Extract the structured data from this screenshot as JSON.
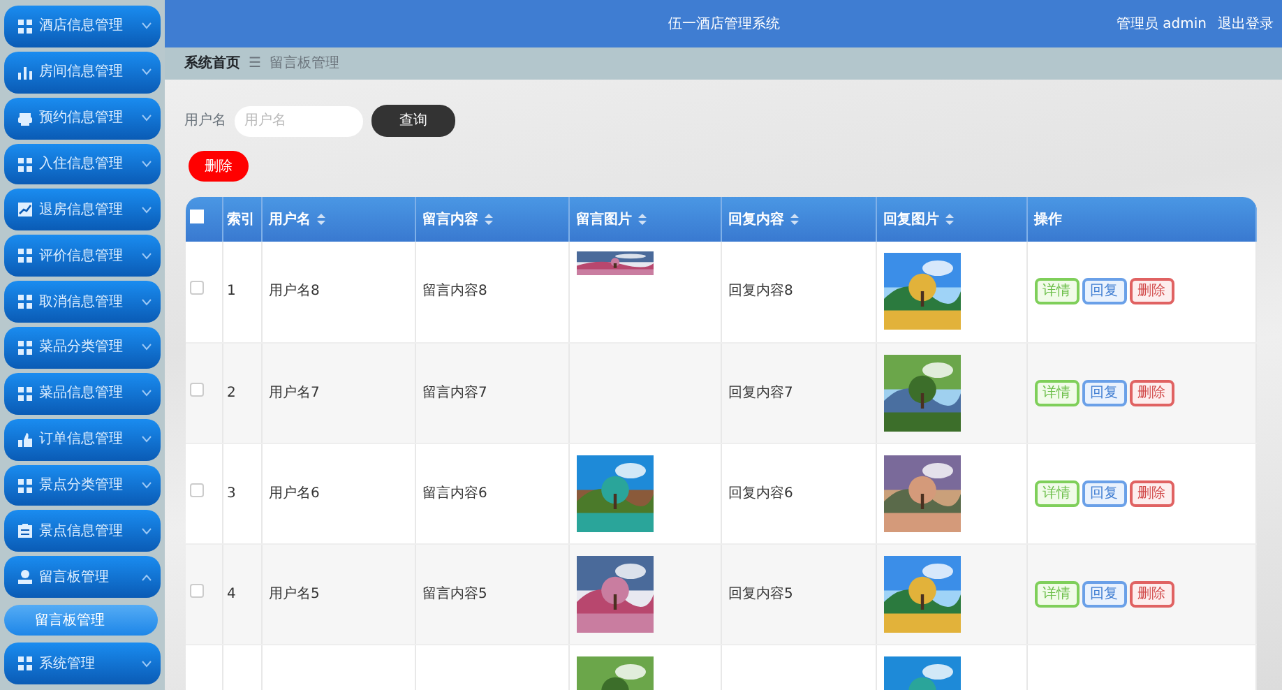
{
  "sidebar": {
    "items": [
      {
        "label": "酒店信息管理",
        "expanded": false
      },
      {
        "label": "房间信息管理",
        "expanded": false
      },
      {
        "label": "预约信息管理",
        "expanded": false
      },
      {
        "label": "入住信息管理",
        "expanded": false
      },
      {
        "label": "退房信息管理",
        "expanded": false
      },
      {
        "label": "评价信息管理",
        "expanded": false
      },
      {
        "label": "取消信息管理",
        "expanded": false
      },
      {
        "label": "菜品分类管理",
        "expanded": false
      },
      {
        "label": "菜品信息管理",
        "expanded": false
      },
      {
        "label": "订单信息管理",
        "expanded": false
      },
      {
        "label": "景点分类管理",
        "expanded": false
      },
      {
        "label": "景点信息管理",
        "expanded": false
      },
      {
        "label": "留言板管理",
        "expanded": true,
        "children": [
          {
            "label": "留言板管理",
            "selected": true
          }
        ]
      },
      {
        "label": "系统管理",
        "expanded": false
      }
    ]
  },
  "header": {
    "title": "伍一酒店管理系统",
    "user": "管理员 admin",
    "logout": "退出登录"
  },
  "breadcrumb": {
    "home": "系统首页",
    "separator": "☰",
    "current": "留言板管理"
  },
  "search": {
    "label": "用户名",
    "placeholder": "用户名",
    "button": "查询"
  },
  "delete_button": "删除",
  "table": {
    "select_all": {
      "checked": false
    },
    "columns": [
      "索引",
      "用户名",
      "留言内容",
      "留言图片",
      "回复内容",
      "回复图片",
      "操作"
    ],
    "rows": [
      {
        "checked": false,
        "index": "1",
        "username": "用户名8",
        "message": "留言内容8",
        "message_image": {
          "kind": "picture",
          "cropped": true
        },
        "reply": "回复内容8",
        "reply_image": {
          "kind": "picture"
        },
        "actions": [
          "详情",
          "回复",
          "删除"
        ]
      },
      {
        "checked": false,
        "index": "2",
        "username": "用户名7",
        "message": "留言内容7",
        "reply": "回复内容7",
        "reply_image": {
          "kind": "picture"
        },
        "actions": [
          "详情",
          "回复",
          "删除"
        ]
      },
      {
        "checked": false,
        "index": "3",
        "username": "用户名6",
        "message": "留言内容6",
        "message_image": {
          "kind": "picture"
        },
        "reply": "回复内容6",
        "reply_image": {
          "kind": "picture"
        },
        "actions": [
          "详情",
          "回复",
          "删除"
        ]
      },
      {
        "checked": false,
        "index": "4",
        "username": "用户名5",
        "message": "留言内容5",
        "message_image": {
          "kind": "picture"
        },
        "reply": "回复内容5",
        "reply_image": {
          "kind": "picture"
        },
        "actions": [
          "详情",
          "回复",
          "删除"
        ]
      },
      {
        "message_image": {
          "kind": "picture"
        },
        "reply_image": {
          "kind": "picture"
        }
      }
    ]
  }
}
